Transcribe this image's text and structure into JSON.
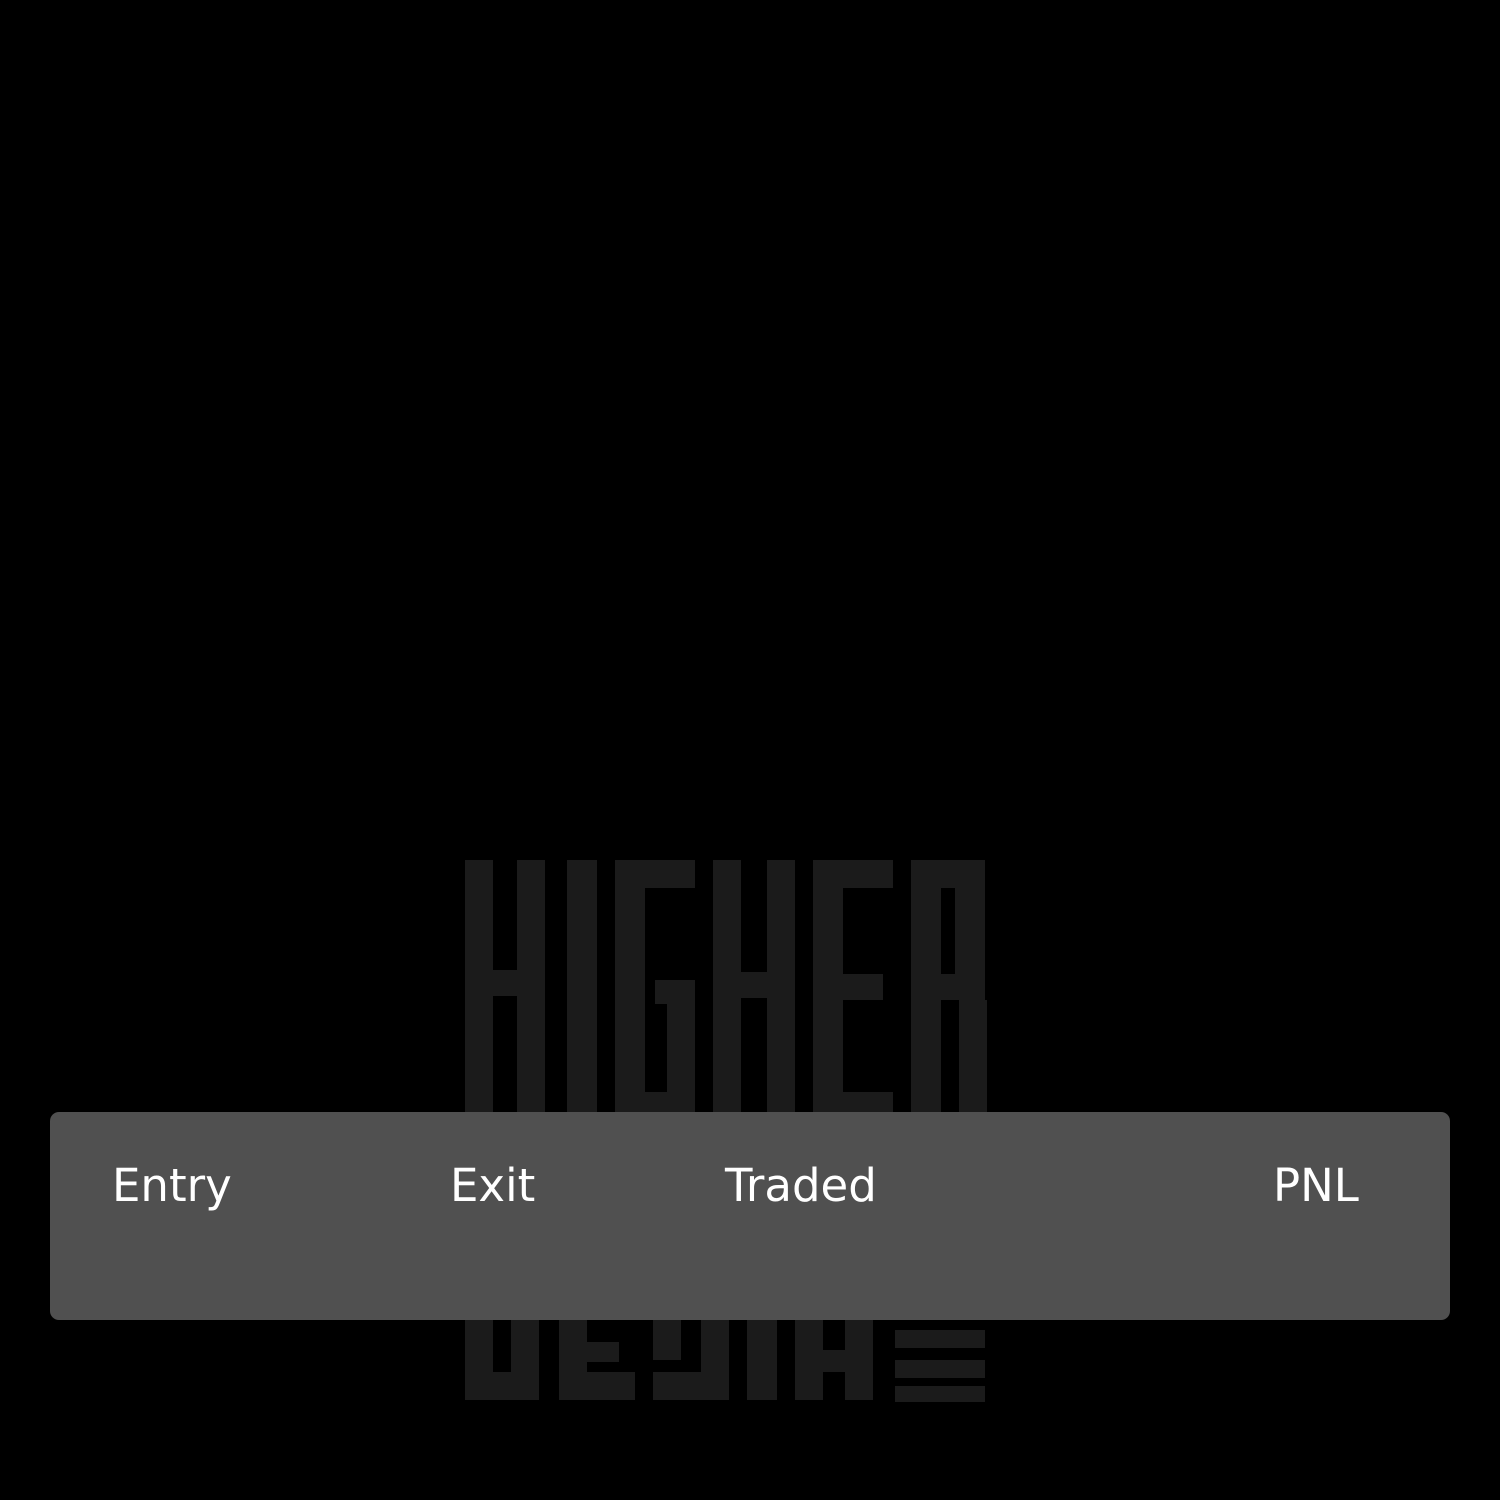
{
  "background": {
    "color": "#000000",
    "watermark_logo": "higher-desire-logo",
    "watermark_lines": [
      "HIGHER",
      "DESIRE"
    ],
    "watermark_color": "#1b1b1b"
  },
  "stats_panel": {
    "background_color": "#505050",
    "text_color": "#ffffff",
    "columns": [
      {
        "label": "Entry",
        "value": ""
      },
      {
        "label": "Exit",
        "value": ""
      },
      {
        "label": "Traded",
        "value": ""
      },
      {
        "label": "PNL",
        "value": ""
      }
    ]
  }
}
